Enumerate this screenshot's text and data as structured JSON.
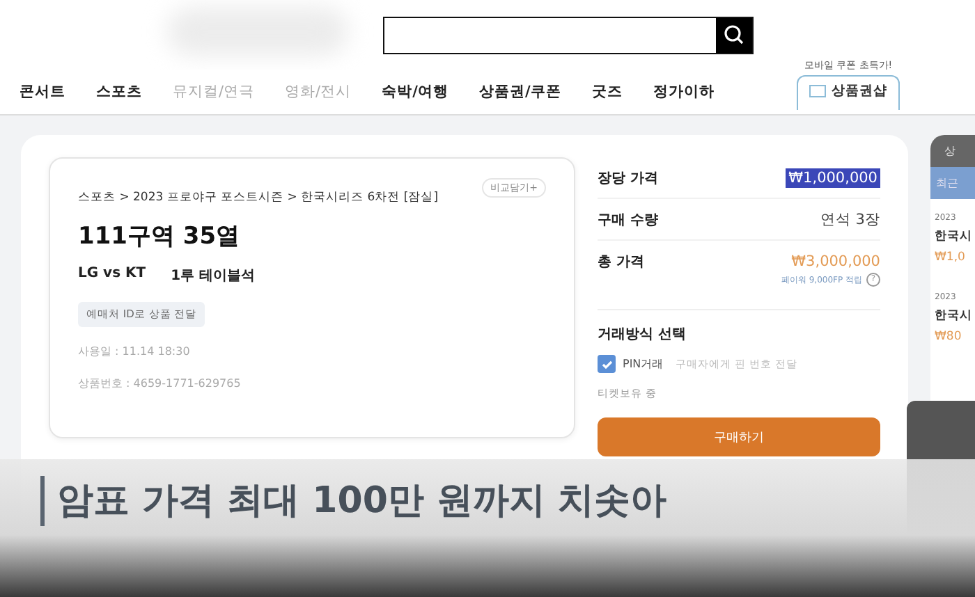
{
  "header": {
    "nav": [
      {
        "label": "콘서트",
        "disabled": false
      },
      {
        "label": "스포츠",
        "disabled": false
      },
      {
        "label": "뮤지컬/연극",
        "disabled": true
      },
      {
        "label": "영화/전시",
        "disabled": true
      },
      {
        "label": "숙박/여행",
        "disabled": false
      },
      {
        "label": "상품권/쿠폰",
        "disabled": false
      },
      {
        "label": "굿즈",
        "disabled": false
      },
      {
        "label": "정가이하",
        "disabled": false
      }
    ],
    "promo_note": "모바일 쿠폰 초특가!",
    "shop_tab": "상품권샵"
  },
  "listing": {
    "compare": "비교담기+",
    "breadcrumb": "스포츠 > 2023 프로야구 포스트시즌 > 한국시리즈 6차전 [잠실]",
    "seat": "111구역 35열",
    "match": "LG vs KT",
    "section": "1루 테이블석",
    "delivery_tag": "예매처 ID로 상품 전달",
    "use_date": "사용일 : 11.14 18:30",
    "product_no": "상품번호 : 4659-1771-629765"
  },
  "order": {
    "rows": [
      {
        "label": "장당 가격",
        "value": "₩1,000,000",
        "highlighted": true
      },
      {
        "label": "구매 수량",
        "value": "연석 3장",
        "highlighted": false
      },
      {
        "label": "총 가격",
        "value": "₩3,000,000",
        "highlighted": false
      }
    ],
    "points_note": "페이워 9,000FP 적립",
    "points_help": "?",
    "method_title": "거래방식 선택",
    "pin": {
      "checked": true,
      "label": "PIN거래",
      "hint": "구매자에게 핀 번호 전달"
    },
    "ticket_note": "티켓보유 중",
    "buy_button": "구매하기"
  },
  "side_panel": {
    "head": "상",
    "tab": "최근",
    "items": [
      {
        "date": "2023",
        "title": "한국시",
        "price": "₩1,0"
      },
      {
        "date": "2023",
        "title": "한국시",
        "price": "₩80"
      }
    ]
  },
  "caption": "암표 가격 최대 100만 원까지 치솟아"
}
